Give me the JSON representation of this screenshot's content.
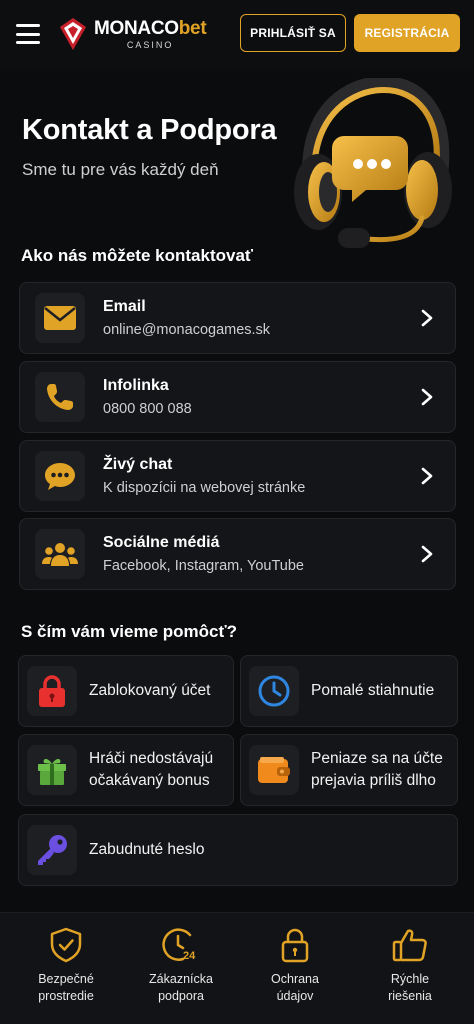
{
  "header": {
    "brand": {
      "name_main": "MONACO",
      "name_accent": "bet",
      "sub": "CASINO"
    },
    "login_label": "PRIHLÁSIŤ SA",
    "register_label": "REGISTRÁCIA"
  },
  "hero": {
    "title": "Kontakt a Podpora",
    "subtitle": "Sme tu pre vás každý deň"
  },
  "contact": {
    "heading": "Ako nás môžete kontaktovať",
    "items": [
      {
        "title": "Email",
        "detail": "online@monacogames.sk",
        "icon": "envelope-icon"
      },
      {
        "title": "Infolinka",
        "detail": "0800 800 088",
        "icon": "phone-icon"
      },
      {
        "title": "Živý chat",
        "detail": "K dispozícii na webovej stránke",
        "icon": "chat-icon"
      },
      {
        "title": "Sociálne médiá",
        "detail": "Facebook, Instagram, YouTube",
        "icon": "people-icon"
      }
    ]
  },
  "help": {
    "heading": "S čím vám vieme pomôcť?",
    "items": [
      {
        "label": "Zablokovaný účet",
        "icon": "lock-icon"
      },
      {
        "label": "Pomalé stiahnutie",
        "icon": "clock-icon"
      },
      {
        "label_line1": "Hráči nedostávajú",
        "label_line2": "očakávaný bonus",
        "icon": "gift-icon"
      },
      {
        "label_line1": "Peniaze sa na účte",
        "label_line2": "prejavia príliš dlho",
        "icon": "wallet-icon"
      },
      {
        "label": "Zabudnuté heslo",
        "icon": "key-icon"
      }
    ]
  },
  "features": [
    {
      "line1": "Bezpečné",
      "line2": "prostredie",
      "icon": "shield-check-icon"
    },
    {
      "line1": "Zákaznícka",
      "line2": "podpora",
      "icon": "clock-24-icon"
    },
    {
      "line1": "Ochrana",
      "line2": "údajov",
      "icon": "padlock-icon"
    },
    {
      "line1": "Rýchle",
      "line2": "riešenia",
      "icon": "thumbs-up-icon"
    }
  ],
  "colors": {
    "accent": "#e1a325",
    "background": "#0b0c0e",
    "card": "#141518",
    "lock_red": "#e8312f",
    "clock_blue": "#2f86e0",
    "gift_green": "#6cc04a",
    "wallet_orange": "#f08a1c",
    "key_purple": "#6a4fe0"
  }
}
